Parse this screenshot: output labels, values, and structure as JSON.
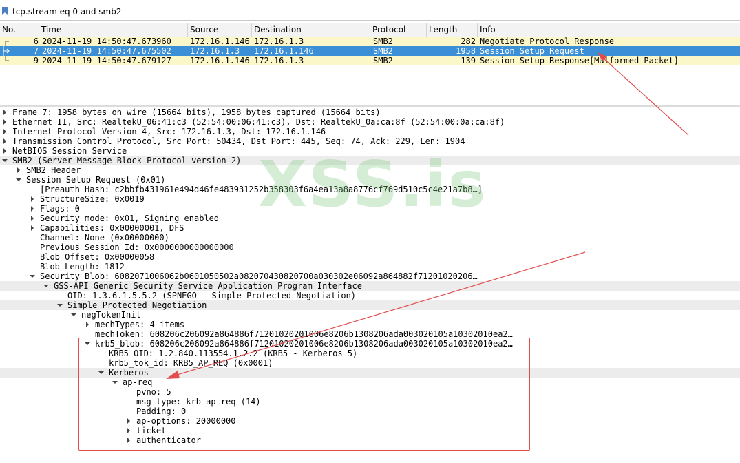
{
  "filter": {
    "value": "tcp.stream eq 0 and smb2"
  },
  "packet_list": {
    "columns": [
      "No.",
      "Time",
      "Source",
      "Destination",
      "Protocol",
      "Length",
      "Info"
    ],
    "rows": [
      {
        "no": "6",
        "time": "2024-11-19 14:50:47.673960",
        "source": "172.16.1.146",
        "destination": "172.16.1.3",
        "protocol": "SMB2",
        "length": "282",
        "info": "Negotiate Protocol Response"
      },
      {
        "no": "7",
        "time": "2024-11-19 14:50:47.675502",
        "source": "172.16.1.3",
        "destination": "172.16.1.146",
        "protocol": "SMB2",
        "length": "1958",
        "info": "Session Setup Request"
      },
      {
        "no": "9",
        "time": "2024-11-19 14:50:47.679127",
        "source": "172.16.1.146",
        "destination": "172.16.1.3",
        "protocol": "SMB2",
        "length": "139",
        "info": "Session Setup Response[Malformed Packet]"
      }
    ]
  },
  "details": [
    "Frame 7: 1958 bytes on wire (15664 bits), 1958 bytes captured (15664 bits)",
    "Ethernet II, Src: RealtekU_06:41:c3 (52:54:00:06:41:c3), Dst: RealtekU_0a:ca:8f (52:54:00:0a:ca:8f)",
    "Internet Protocol Version 4, Src: 172.16.1.3, Dst: 172.16.1.146",
    "Transmission Control Protocol, Src Port: 50434, Dst Port: 445, Seq: 74, Ack: 229, Len: 1904",
    "NetBIOS Session Service",
    "SMB2 (Server Message Block Protocol version 2)",
    "SMB2 Header",
    "Session Setup Request (0x01)",
    "[Preauth Hash: c2bbfb431961e494d46fe483931252b358303f6a4ea13a8a8776cf769d510c5c4e21a7b8…]",
    "StructureSize: 0x0019",
    "Flags: 0",
    "Security mode: 0x01, Signing enabled",
    "Capabilities: 0x00000001, DFS",
    "Channel: None (0x00000000)",
    "Previous Session Id: 0x0000000000000000",
    "Blob Offset: 0x00000058",
    "Blob Length: 1812",
    "Security Blob: 6082071006062b0601050502a082070430820700a030302e06092a864882f71201020206…",
    "GSS-API Generic Security Service Application Program Interface",
    "OID: 1.3.6.1.5.5.2 (SPNEGO - Simple Protected Negotiation)",
    "Simple Protected Negotiation",
    "negTokenInit",
    "mechTypes: 4 items",
    "mechToken: 608206c206092a864886f71201020201006e8206b1308206ada003020105a10302010ea2…",
    "krb5_blob: 608206c206092a864886f71201020201006e8206b1308206ada003020105a10302010ea2…",
    "KRB5 OID: 1.2.840.113554.1.2.2 (KRB5 - Kerberos 5)",
    "krb5_tok_id: KRB5_AP_REQ (0x0001)",
    "Kerberos",
    "ap-req",
    "pvno: 5",
    "msg-type: krb-ap-req (14)",
    "Padding: 0",
    "ap-options: 20000000",
    "ticket",
    "authenticator"
  ],
  "watermark": "XSS.is",
  "colors": {
    "selected_row": "#3b8fd6",
    "conversation_row": "#fcf7c8",
    "annotation": "#e24c4c",
    "watermark": "#78c878"
  }
}
